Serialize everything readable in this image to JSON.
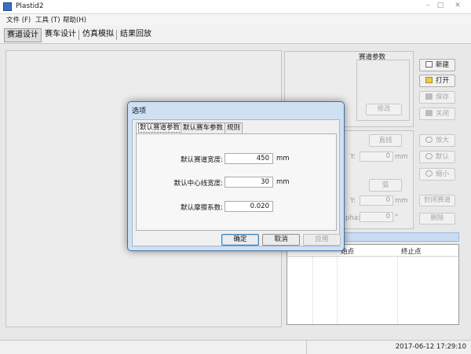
{
  "window": {
    "title": "Plastid2",
    "controls": [
      "–",
      "□",
      "✕"
    ]
  },
  "menu": [
    {
      "label": "文件 (F)"
    },
    {
      "label": "工具 (T)"
    },
    {
      "label": "帮助(H)"
    }
  ],
  "tabs": [
    {
      "label": "赛道设计",
      "active": true
    },
    {
      "label": "赛车设计"
    },
    {
      "label": "仿真模拟"
    },
    {
      "label": "结果回放"
    }
  ],
  "right_panel": {
    "section_title": "赛道参数",
    "modify": "修改",
    "line": "直线",
    "arc": "弧",
    "close_track": "封闭赛道",
    "delete": "删除",
    "y1_label": "Y:",
    "y1_value": "0",
    "y1_unit": "mm",
    "y2_label": "Y:",
    "y2_value": "0",
    "y2_unit": "mm",
    "alpha_label": "pha:",
    "alpha_value": "0",
    "alpha_unit": "°",
    "new": "新建",
    "open": "打开",
    "save": "保存",
    "close": "关闭",
    "zoom_in": "放大",
    "default": "默认",
    "zoom_out": "缩小"
  },
  "table": {
    "columns": [
      "",
      "",
      "起始点",
      "终止点"
    ],
    "visible_columns": [
      "始点",
      "终止点"
    ]
  },
  "status": {
    "clock": "2017-06-12 17:29:10"
  },
  "dialog": {
    "title": "选项",
    "tabs": [
      {
        "label": "默认赛道参数",
        "active": true
      },
      {
        "label": "默认赛车参数"
      },
      {
        "label": "规则"
      }
    ],
    "fields": [
      {
        "label": "默认赛道宽度:",
        "value": "450",
        "unit": "mm"
      },
      {
        "label": "默认中心线宽度:",
        "value": "30",
        "unit": "mm"
      },
      {
        "label": "默认摩擦系数:",
        "value": "0.020",
        "unit": ""
      }
    ],
    "buttons": {
      "ok": "确定",
      "cancel": "取消",
      "apply": "应用"
    }
  },
  "colors": {
    "accent": "#3a6fc4",
    "dialog_frame": "#cfe0f3",
    "table_header_bar": "#c9dcf2"
  }
}
